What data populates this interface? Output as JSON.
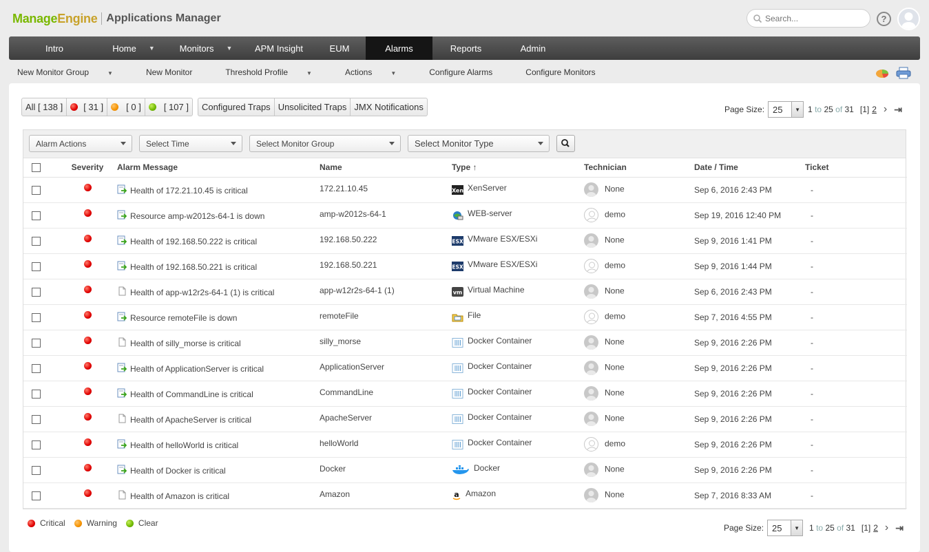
{
  "brand": {
    "manage": "Manage",
    "engine": "Engine",
    "product": "Applications Manager"
  },
  "search": {
    "placeholder": "Search..."
  },
  "help_label": "?",
  "topnav": [
    {
      "label": "Intro"
    },
    {
      "label": "Home",
      "dropdown": true
    },
    {
      "label": "Monitors",
      "dropdown": true
    },
    {
      "label": "APM Insight"
    },
    {
      "label": "EUM"
    },
    {
      "label": "Alarms",
      "active": true
    },
    {
      "label": "Reports"
    },
    {
      "label": "Admin"
    }
  ],
  "subnav": [
    {
      "label": "New Monitor Group",
      "dropdown": true
    },
    {
      "label": "New Monitor"
    },
    {
      "label": "Threshold Profile",
      "dropdown": true
    },
    {
      "label": "Actions",
      "dropdown": true
    },
    {
      "label": "Configure Alarms"
    },
    {
      "label": "Configure Monitors"
    }
  ],
  "filters": {
    "all": "All [ 138 ]",
    "critical_count": "[ 31 ]",
    "warning_count": "[ 0 ]",
    "clear_count": "[ 107 ]",
    "configured_traps": "Configured Traps",
    "unsolicited_traps": "Unsolicited Traps",
    "jmx": "JMX Notifications"
  },
  "pager": {
    "label": "Page Size:",
    "size": "25",
    "from": "1",
    "to_word": "to",
    "to": "25",
    "of_word": "of",
    "total": "31",
    "current": "[1]",
    "next_page": "2",
    "next_icon": "›",
    "last_icon": "⇥"
  },
  "toolbar": {
    "alarm_actions": "Alarm Actions",
    "select_time": "Select Time",
    "select_group": "Select Monitor Group",
    "select_type": "Select Monitor Type"
  },
  "table": {
    "headers": {
      "severity": "Severity",
      "message": "Alarm Message",
      "name": "Name",
      "type": "Type",
      "sort_arrow": "↑",
      "technician": "Technician",
      "datetime": "Date / Time",
      "ticket": "Ticket"
    },
    "rows": [
      {
        "severity": "critical",
        "msgicon": "edit",
        "message": "Health of 172.21.10.45 is critical",
        "name": "172.21.10.45",
        "typeicon": "xen-icon",
        "type": "XenServer",
        "technician": "None",
        "date": "Sep 6, 2016 2:43 PM",
        "ticket": "-"
      },
      {
        "severity": "critical",
        "msgicon": "edit",
        "message": "Resource amp-w2012s-64-1 is down",
        "name": "amp-w2012s-64-1",
        "typeicon": "web-icon",
        "type": "WEB-server",
        "technician": "demo",
        "date": "Sep 19, 2016 12:40 PM",
        "ticket": "-"
      },
      {
        "severity": "critical",
        "msgicon": "edit",
        "message": "Health of 192.168.50.222 is critical",
        "name": "192.168.50.222",
        "typeicon": "esx-icon",
        "type": "VMware ESX/ESXi",
        "technician": "None",
        "date": "Sep 9, 2016 1:41 PM",
        "ticket": "-"
      },
      {
        "severity": "critical",
        "msgicon": "edit",
        "message": "Health of 192.168.50.221 is critical",
        "name": "192.168.50.221",
        "typeicon": "esx-icon",
        "type": "VMware ESX/ESXi",
        "technician": "demo",
        "date": "Sep 9, 2016 1:44 PM",
        "ticket": "-"
      },
      {
        "severity": "critical",
        "msgicon": "doc",
        "message": "Health of app-w12r2s-64-1 (1) is critical",
        "name": "app-w12r2s-64-1 (1)",
        "typeicon": "vm-icon",
        "type": "Virtual Machine",
        "technician": "None",
        "date": "Sep 6, 2016 2:43 PM",
        "ticket": "-"
      },
      {
        "severity": "critical",
        "msgicon": "edit",
        "message": "Resource remoteFile is down",
        "name": "remoteFile",
        "typeicon": "file-icon",
        "type": "File",
        "technician": "demo",
        "date": "Sep 7, 2016 4:55 PM",
        "ticket": "-"
      },
      {
        "severity": "critical",
        "msgicon": "doc",
        "message": "Health of silly_morse is critical",
        "name": "silly_morse",
        "typeicon": "docker-container-icon",
        "type": "Docker Container",
        "technician": "None",
        "date": "Sep 9, 2016 2:26 PM",
        "ticket": "-"
      },
      {
        "severity": "critical",
        "msgicon": "edit",
        "message": "Health of ApplicationServer is critical",
        "name": "ApplicationServer",
        "typeicon": "docker-container-icon",
        "type": "Docker Container",
        "technician": "None",
        "date": "Sep 9, 2016 2:26 PM",
        "ticket": "-"
      },
      {
        "severity": "critical",
        "msgicon": "edit",
        "message": "Health of CommandLine is critical",
        "name": "CommandLine",
        "typeicon": "docker-container-icon",
        "type": "Docker Container",
        "technician": "None",
        "date": "Sep 9, 2016 2:26 PM",
        "ticket": "-"
      },
      {
        "severity": "critical",
        "msgicon": "doc",
        "message": "Health of ApacheServer is critical",
        "name": "ApacheServer",
        "typeicon": "docker-container-icon",
        "type": "Docker Container",
        "technician": "None",
        "date": "Sep 9, 2016 2:26 PM",
        "ticket": "-"
      },
      {
        "severity": "critical",
        "msgicon": "edit",
        "message": "Health of helloWorld is critical",
        "name": "helloWorld",
        "typeicon": "docker-container-icon",
        "type": "Docker Container",
        "technician": "demo",
        "date": "Sep 9, 2016 2:26 PM",
        "ticket": "-"
      },
      {
        "severity": "critical",
        "msgicon": "edit",
        "message": "Health of Docker is critical",
        "name": "Docker",
        "typeicon": "docker-icon",
        "type": "Docker",
        "technician": "None",
        "date": "Sep 9, 2016 2:26 PM",
        "ticket": "-"
      },
      {
        "severity": "critical",
        "msgicon": "doc",
        "message": "Health of Amazon is critical",
        "name": "Amazon",
        "typeicon": "amazon-icon",
        "type": "Amazon",
        "technician": "None",
        "date": "Sep 7, 2016 8:33 AM",
        "ticket": "-"
      }
    ]
  },
  "legend": {
    "critical": "Critical",
    "warning": "Warning",
    "clear": "Clear"
  },
  "colors": {
    "critical": "#e00000",
    "warning": "#f59300",
    "clear": "#6fb800",
    "nav_active": "#151515"
  }
}
